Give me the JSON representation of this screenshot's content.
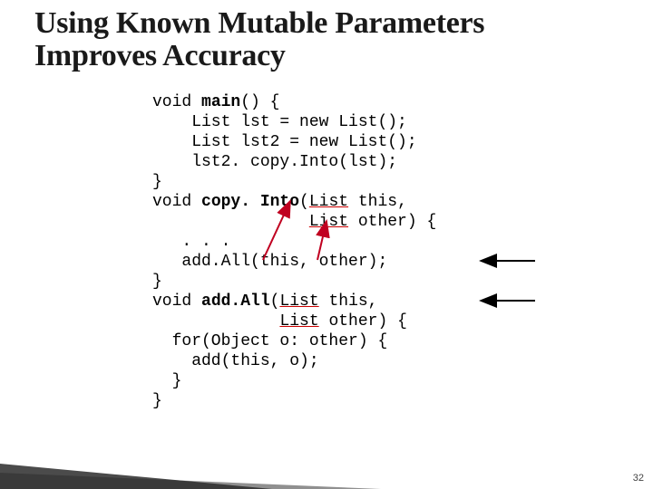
{
  "title": "Using Known Mutable Parameters Improves Accuracy",
  "slide_number": "32",
  "code": {
    "l1a": "void ",
    "l1b": "main",
    "l1c": "() {",
    "l2": "    List lst = new List();",
    "l3": "    List lst2 = new List();",
    "l4": "    lst2. copy.Into(lst);",
    "l5": "}",
    "l6a": "void ",
    "l6b": "copy. Into",
    "l6c": "(",
    "l6d": "List",
    "l6e": " this,",
    "l7a": "                ",
    "l7b": "List",
    "l7c": " other) {",
    "l8": "   . . .",
    "l9": "   add.All(this, other);",
    "l10": "}",
    "l11a": "void ",
    "l11b": "add.All",
    "l11c": "(",
    "l11d": "List",
    "l11e": " this,",
    "l12a": "             ",
    "l12b": "List",
    "l12c": " other) {",
    "l13": "  for(Object o: other) {",
    "l14": "    add(this, o);",
    "l15": "  }",
    "l16": "}"
  }
}
